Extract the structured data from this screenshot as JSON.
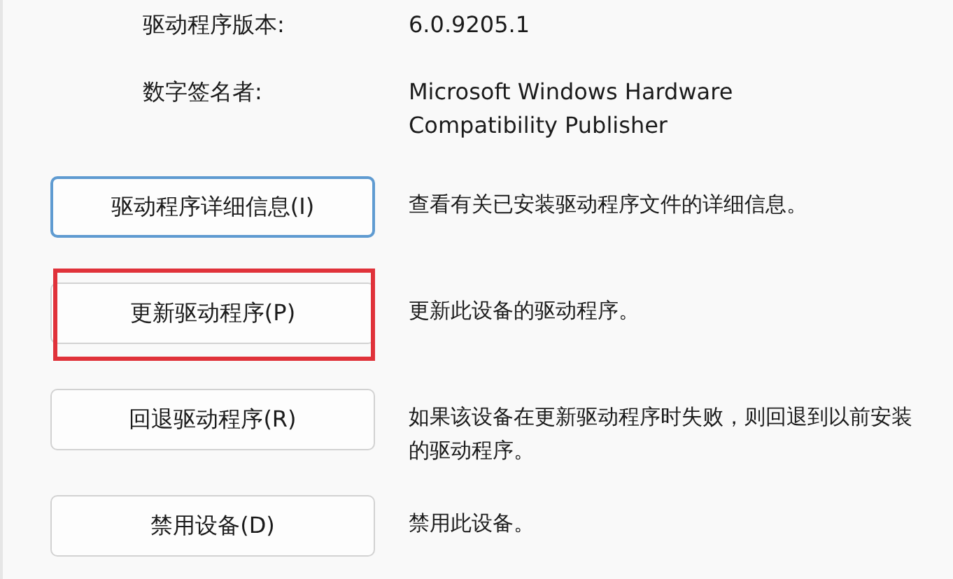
{
  "properties": [
    {
      "label": "驱动程序版本:",
      "lines": [
        "6.0.9205.1"
      ]
    },
    {
      "label": "数字签名者:",
      "lines": [
        "Microsoft Windows Hardware",
        "Compatibility Publisher"
      ]
    }
  ],
  "actions": [
    {
      "button": "驱动程序详细信息(I)",
      "focused": true,
      "highlighted": false,
      "description": "查看有关已安装驱动程序文件的详细信息。"
    },
    {
      "button": "更新驱动程序(P)",
      "focused": false,
      "highlighted": true,
      "description": "更新此设备的驱动程序。"
    },
    {
      "button": "回退驱动程序(R)",
      "focused": false,
      "highlighted": false,
      "description": "如果该设备在更新驱动程序时失败，则回退到以前安装的驱动程序。"
    },
    {
      "button": "禁用设备(D)",
      "focused": false,
      "highlighted": false,
      "description": "禁用此设备。"
    }
  ]
}
